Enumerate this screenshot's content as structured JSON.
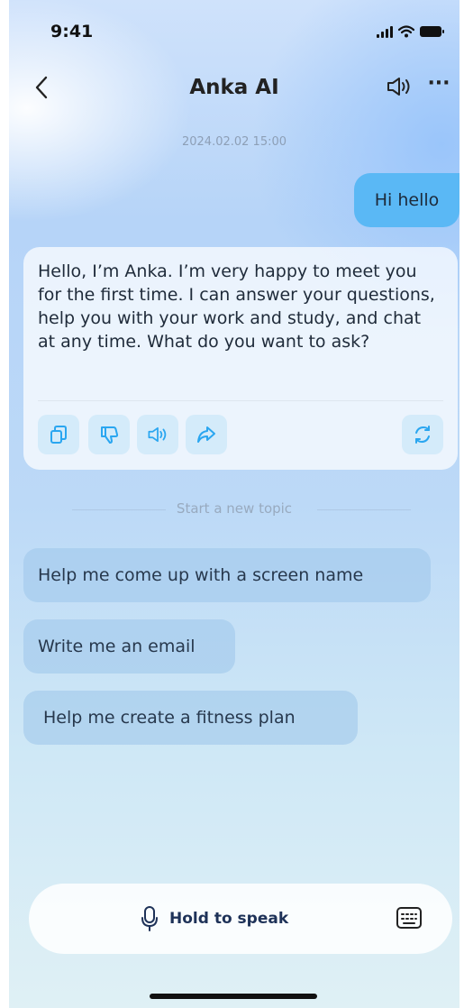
{
  "status_bar": {
    "time": "9:41"
  },
  "nav": {
    "title": "Anka AI",
    "more_label": "···"
  },
  "chat": {
    "timestamp": "2024.02.02 15:00",
    "user_message": "Hi hello",
    "ai_message": "Hello, I’m Anka. I’m very happy to meet you for the first time. I can answer your questions, help you with your work and study, and chat at any time. What do you want to ask?",
    "ai_actions": [
      "copy-icon",
      "thumbs-down-icon",
      "speaker-icon",
      "share-icon",
      "refresh-icon"
    ]
  },
  "topic": {
    "separator_label": "Start a new topic",
    "suggestions": [
      {
        "label": "Help me come up with a screen name"
      },
      {
        "label": "Write me an email"
      },
      {
        "label": "Help me create a fitness plan"
      }
    ]
  },
  "input": {
    "hold_label": "Hold to speak"
  },
  "colors": {
    "accent": "#2aa6f0",
    "user_bubble": "#5ab8f5",
    "action_button_bg": "#d4ebfa",
    "title_text": "#222222",
    "hold_text": "#1e3258"
  }
}
